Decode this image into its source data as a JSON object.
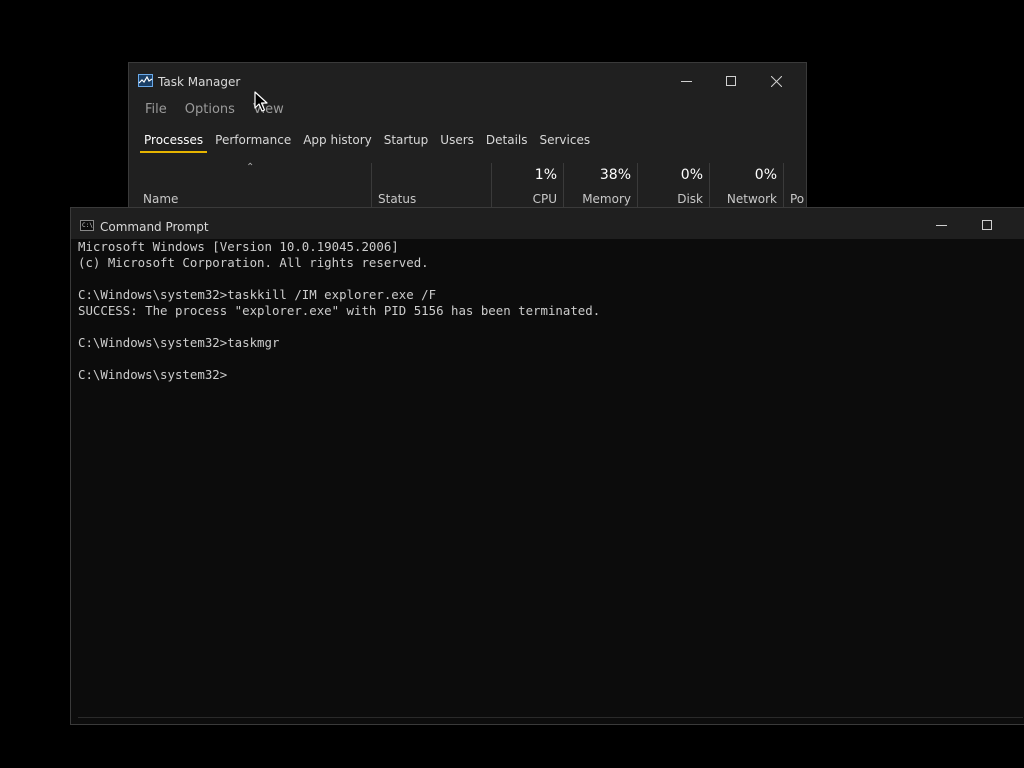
{
  "task_manager": {
    "title": "Task Manager",
    "menu": [
      "File",
      "Options",
      "View"
    ],
    "tabs": [
      "Processes",
      "Performance",
      "App history",
      "Startup",
      "Users",
      "Details",
      "Services"
    ],
    "active_tab": "Processes",
    "columns": {
      "name": "Name",
      "status": "Status",
      "cpu": {
        "percent": "1%",
        "label": "CPU"
      },
      "memory": {
        "percent": "38%",
        "label": "Memory"
      },
      "disk": {
        "percent": "0%",
        "label": "Disk"
      },
      "network": {
        "percent": "0%",
        "label": "Network"
      },
      "power": "Po"
    },
    "icons": {
      "app": "task-manager-icon",
      "minimize": "minimize-icon",
      "maximize": "maximize-icon",
      "close": "close-icon",
      "sort": "sort-caret-icon"
    },
    "accent": "#e6b400"
  },
  "command_prompt": {
    "title": "Command Prompt",
    "lines": [
      "Microsoft Windows [Version 10.0.19045.2006]",
      "(c) Microsoft Corporation. All rights reserved.",
      "",
      "C:\\Windows\\system32>taskkill /IM explorer.exe /F",
      "SUCCESS: The process \"explorer.exe\" with PID 5156 has been terminated.",
      "",
      "C:\\Windows\\system32>taskmgr",
      "",
      "C:\\Windows\\system32>"
    ],
    "icons": {
      "app": "cmd-icon",
      "minimize": "minimize-icon",
      "maximize": "maximize-icon"
    }
  }
}
